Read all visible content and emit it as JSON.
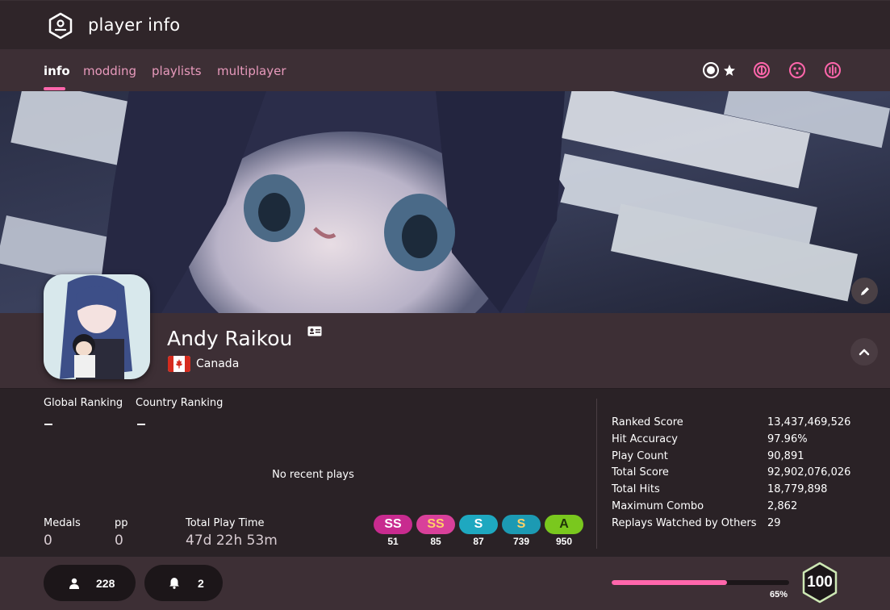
{
  "header": {
    "title": "player info"
  },
  "tabs": [
    {
      "label": "info"
    },
    {
      "label": "modding"
    },
    {
      "label": "playlists"
    },
    {
      "label": "multiplayer"
    }
  ],
  "modes": [
    "osu-standard-icon",
    "taiko-icon",
    "catch-icon",
    "mania-icon"
  ],
  "profile": {
    "username": "Andy Raikou",
    "country": "Canada"
  },
  "ranking": {
    "global_label": "Global Ranking",
    "country_label": "Country Ranking"
  },
  "recent": {
    "empty_text": "No recent plays"
  },
  "summary": {
    "medals_label": "Medals",
    "medals_value": "0",
    "pp_label": "pp",
    "pp_value": "0",
    "playtime_label": "Total Play Time",
    "playtime_value": "47d 22h 53m"
  },
  "grades": [
    {
      "grade": "SS",
      "count": "51",
      "color": "#c82b8f"
    },
    {
      "grade": "SS",
      "count": "85",
      "color": "#d9409a"
    },
    {
      "grade": "S",
      "count": "87",
      "color": "#1ea8c0"
    },
    {
      "grade": "S",
      "count": "739",
      "color": "#1c9ab3"
    },
    {
      "grade": "A",
      "count": "950",
      "color": "#7ac81e"
    }
  ],
  "stats": [
    {
      "label": "Ranked Score",
      "value": "13,437,469,526"
    },
    {
      "label": "Hit Accuracy",
      "value": "97.96%"
    },
    {
      "label": "Play Count",
      "value": "90,891"
    },
    {
      "label": "Total Score",
      "value": "92,902,076,026"
    },
    {
      "label": "Total Hits",
      "value": "18,779,898"
    },
    {
      "label": "Maximum Combo",
      "value": "2,862"
    },
    {
      "label": "Replays Watched by Others",
      "value": "29"
    }
  ],
  "social": {
    "followers": "228",
    "notifications": "2"
  },
  "level": {
    "value": "100",
    "progress_text": "65%",
    "progress": 0.65
  },
  "colors": {
    "accent": "#ff66ab",
    "tab_inactive": "#e89abc",
    "panel": "#3d2f35",
    "background": "#2a2226"
  }
}
